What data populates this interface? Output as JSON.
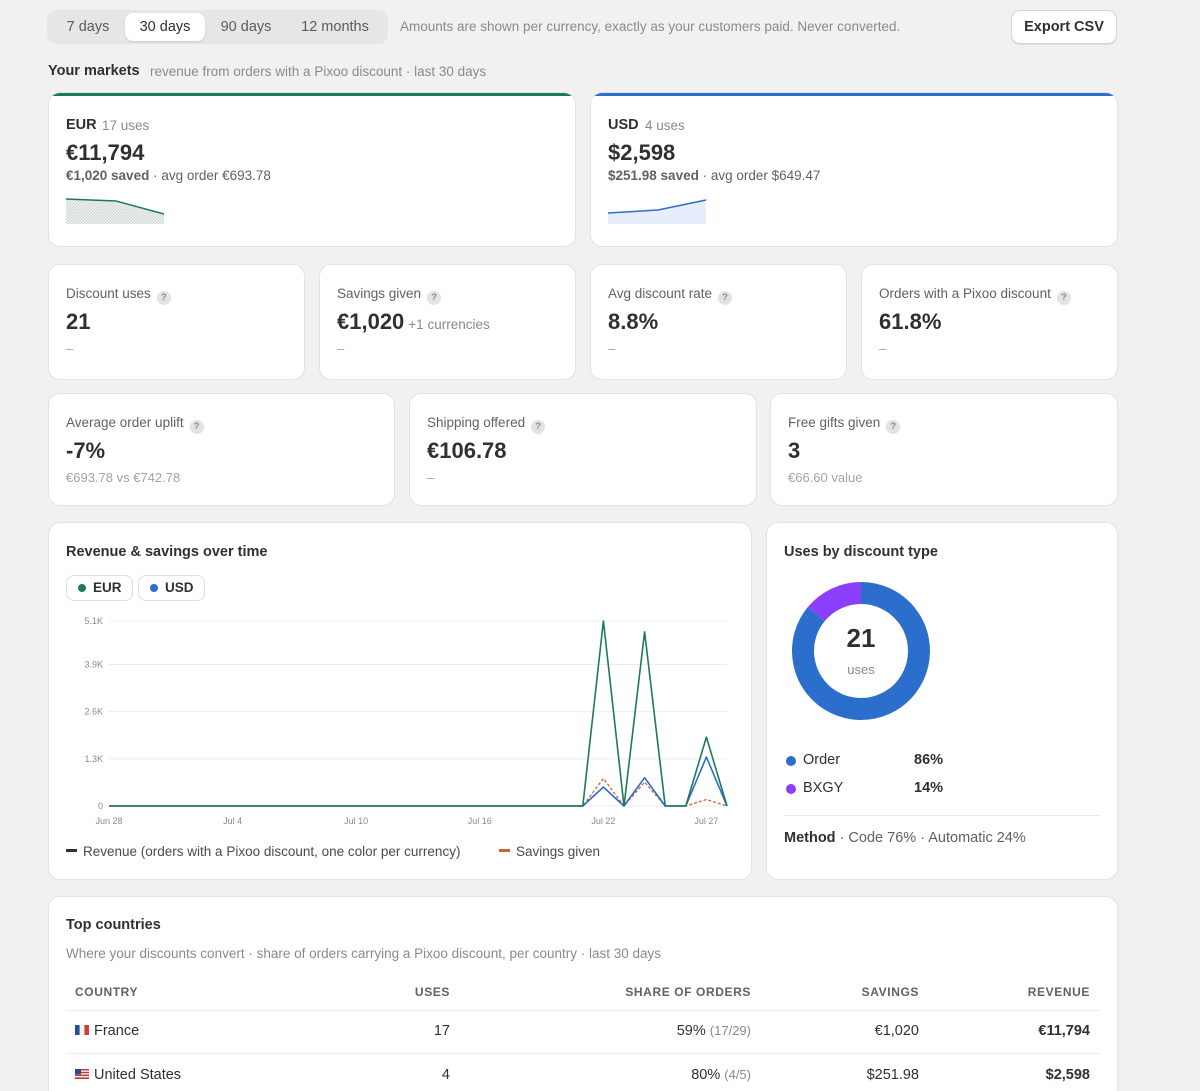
{
  "range_tabs": [
    "7 days",
    "30 days",
    "90 days",
    "12 months"
  ],
  "active_tab": "30 days",
  "top_note": "Amounts are shown per currency, exactly as your customers paid. Never converted.",
  "export_label": "Export CSV",
  "markets": {
    "title": "Your markets",
    "subtitle": "revenue from orders with a Pixoo discount · last 30 days",
    "eur": {
      "code": "EUR",
      "uses": "17 uses",
      "total": "€11,794",
      "saved": "€1,020 saved",
      "avg": "· avg order €693.78",
      "accent": "#1f7a5a"
    },
    "usd": {
      "code": "USD",
      "uses": "4 uses",
      "total": "$2,598",
      "saved": "$251.98 saved",
      "avg": "· avg order $649.47",
      "accent": "#2c6ecb"
    }
  },
  "kpis": {
    "discount_uses": {
      "label": "Discount uses",
      "value": "21",
      "sub": "–"
    },
    "savings_given": {
      "label": "Savings given",
      "value": "€1,020",
      "extra": "+1 currencies",
      "sub": "–"
    },
    "avg_rate": {
      "label": "Avg discount rate",
      "value": "8.8%",
      "sub": "–"
    },
    "orders_share": {
      "label": "Orders with a Pixoo discount",
      "value": "61.8%",
      "sub": "–"
    },
    "uplift": {
      "label": "Average order uplift",
      "value": "-7%",
      "sub": "€693.78 vs €742.78"
    },
    "shipping": {
      "label": "Shipping offered",
      "value": "€106.78",
      "sub": "–"
    },
    "gifts": {
      "label": "Free gifts given",
      "value": "3",
      "sub": "€66.60 value"
    }
  },
  "revenue_chart": {
    "title": "Revenue & savings over time",
    "legend": [
      "EUR",
      "USD"
    ],
    "foot_revenue": "Revenue (orders with a Pixoo discount, one color per currency)",
    "foot_savings": "Savings given",
    "colors": {
      "eur": "#1f7a5a",
      "usd": "#2c6ecb",
      "savings": "#c8643c"
    }
  },
  "chart_data": {
    "type": "line",
    "title": "Revenue & savings over time",
    "x": [
      "Jun 28",
      "Jun 29",
      "Jun 30",
      "Jul 1",
      "Jul 2",
      "Jul 3",
      "Jul 4",
      "Jul 5",
      "Jul 6",
      "Jul 7",
      "Jul 8",
      "Jul 9",
      "Jul 10",
      "Jul 11",
      "Jul 12",
      "Jul 13",
      "Jul 14",
      "Jul 15",
      "Jul 16",
      "Jul 17",
      "Jul 18",
      "Jul 19",
      "Jul 20",
      "Jul 21",
      "Jul 22",
      "Jul 23",
      "Jul 24",
      "Jul 25",
      "Jul 26",
      "Jul 27",
      "Jul 28"
    ],
    "xticks": [
      "Jun 28",
      "Jul 4",
      "Jul 10",
      "Jul 16",
      "Jul 22",
      "Jul 27"
    ],
    "yticks": [
      "0",
      "1.3K",
      "2.6K",
      "3.9K",
      "5.1K"
    ],
    "ylim": [
      0,
      5100
    ],
    "series": [
      {
        "name": "EUR",
        "values": [
          0,
          0,
          0,
          0,
          0,
          0,
          0,
          0,
          0,
          0,
          0,
          0,
          0,
          0,
          0,
          0,
          0,
          0,
          0,
          0,
          0,
          0,
          0,
          0,
          5100,
          0,
          4800,
          0,
          0,
          1900,
          0
        ]
      },
      {
        "name": "USD",
        "values": [
          0,
          0,
          0,
          0,
          0,
          0,
          0,
          0,
          0,
          0,
          0,
          0,
          0,
          0,
          0,
          0,
          0,
          0,
          0,
          0,
          0,
          0,
          0,
          0,
          520,
          0,
          780,
          0,
          0,
          1350,
          0
        ]
      },
      {
        "name": "Savings given",
        "values": [
          0,
          0,
          0,
          0,
          0,
          0,
          0,
          0,
          0,
          0,
          0,
          0,
          0,
          0,
          0,
          0,
          0,
          0,
          0,
          0,
          0,
          0,
          0,
          0,
          760,
          0,
          660,
          0,
          0,
          180,
          0
        ]
      }
    ]
  },
  "donut": {
    "title": "Uses by discount type",
    "total": "21",
    "total_label": "uses",
    "items": [
      {
        "name": "Order",
        "pct": "86%",
        "value": 86,
        "color": "#2c6ecb"
      },
      {
        "name": "BXGY",
        "pct": "14%",
        "value": 14,
        "color": "#8a3ffc"
      }
    ],
    "method_label": "Method",
    "method_text": "· Code 76% · Automatic 24%"
  },
  "countries": {
    "title": "Top countries",
    "subtitle": "Where your discounts convert · share of orders carrying a Pixoo discount, per country · last 30 days",
    "headers": [
      "COUNTRY",
      "USES",
      "SHARE OF ORDERS",
      "SAVINGS",
      "REVENUE"
    ],
    "rows": [
      {
        "country": "France",
        "uses": "17",
        "share": "59%",
        "share_detail": "(17/29)",
        "savings": "€1,020",
        "revenue": "€11,794"
      },
      {
        "country": "United States",
        "uses": "4",
        "share": "80%",
        "share_detail": "(4/5)",
        "savings": "$251.98",
        "revenue": "$2,598"
      }
    ]
  }
}
